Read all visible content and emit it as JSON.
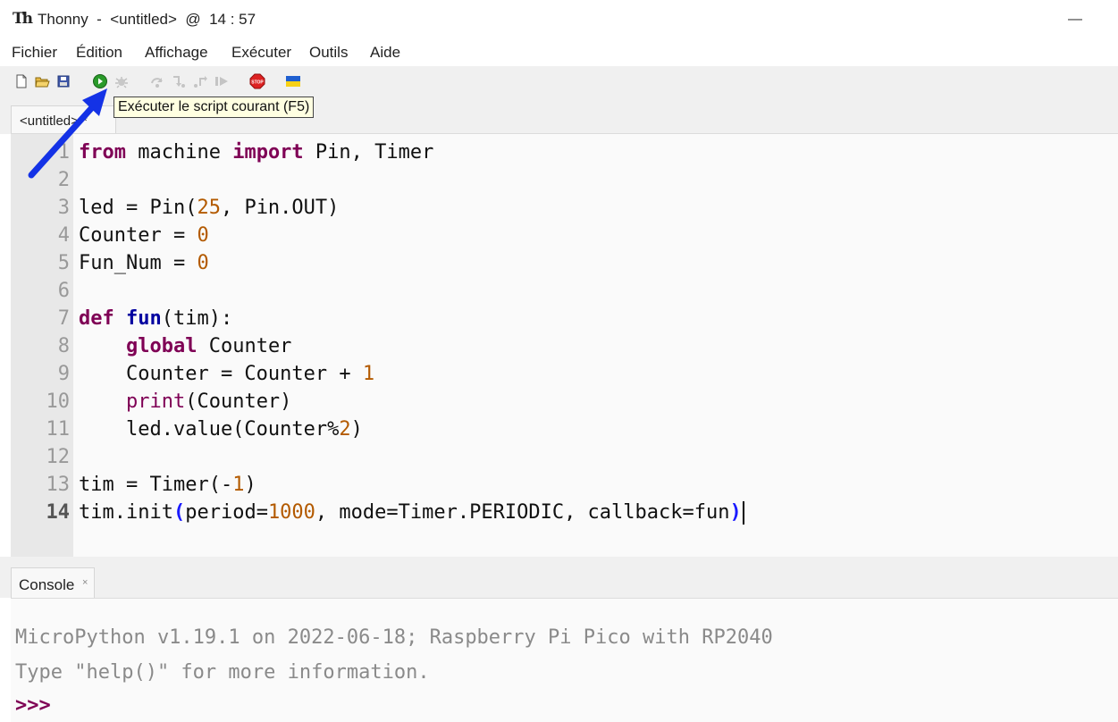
{
  "window": {
    "title": "Thonny  -  <untitled>  @  14 : 57",
    "logo_text": "Th",
    "controls": {
      "minimize": "—"
    }
  },
  "menu": [
    "Fichier",
    "Édition",
    "Affichage",
    "Exécuter",
    "Outils",
    "Aide"
  ],
  "toolbar": {
    "icons": [
      "new-file-icon",
      "open-folder-icon",
      "save-icon",
      "run-icon",
      "debug-icon",
      "step-over-icon",
      "step-into-icon",
      "step-out-icon",
      "resume-icon",
      "stop-icon",
      "ukraine-flag-icon"
    ],
    "tooltip": "Exécuter le script courant (F5)"
  },
  "editor": {
    "tab": {
      "label": "<untitled> *",
      "close": ""
    },
    "current_line": 14,
    "lines": [
      "from machine import Pin, Timer",
      "",
      "led = Pin(25, Pin.OUT)",
      "Counter = 0",
      "Fun_Num = 0",
      "",
      "def fun(tim):",
      "    global Counter",
      "    Counter = Counter + 1",
      "    print(Counter)",
      "    led.value(Counter%2)",
      "",
      "tim = Timer(-1)",
      "tim.init(period=1000, mode=Timer.PERIODIC, callback=fun)"
    ],
    "line_numbers": [
      "1",
      "2",
      "3",
      "4",
      "5",
      "6",
      "7",
      "8",
      "9",
      "10",
      "11",
      "12",
      "13",
      "14"
    ]
  },
  "console": {
    "tab_label": "Console",
    "tab_close": "×",
    "lines": [
      "MicroPython v1.19.1 on 2022-06-18; Raspberry Pi Pico with RP2040",
      "Type \"help()\" for more information."
    ],
    "prompt": ">>>"
  },
  "colors": {
    "keyword": "#7f0055",
    "number": "#b35a00",
    "annotation_arrow": "#1432e6"
  }
}
